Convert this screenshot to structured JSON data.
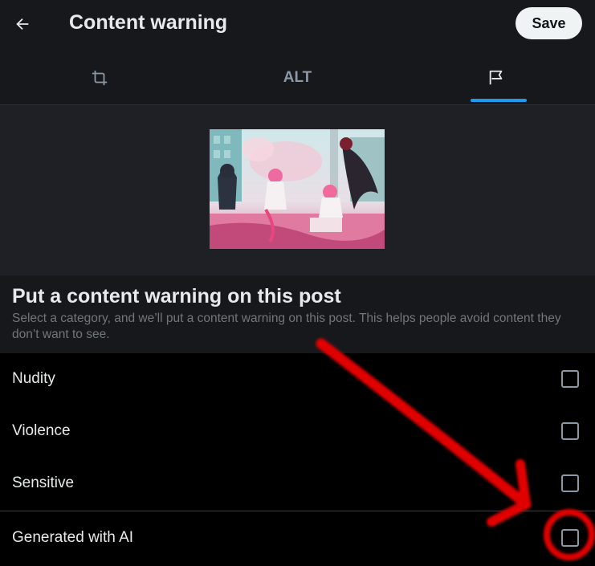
{
  "header": {
    "title": "Content warning",
    "save_label": "Save",
    "back_icon": "arrow-left-icon"
  },
  "tabs": [
    {
      "icon": "crop-icon",
      "label": ""
    },
    {
      "label": "ALT"
    },
    {
      "icon": "flag-icon",
      "label": "",
      "active": true
    }
  ],
  "preview": {
    "image_icon": "anime-illustration-thumbnail"
  },
  "intro": {
    "heading": "Put a content warning on this post",
    "description": "Select a category, and we’ll put a content warning on this post. This helps people avoid content they don’t want to see."
  },
  "options": [
    {
      "label": "Nudity",
      "checked": false
    },
    {
      "label": "Violence",
      "checked": false
    },
    {
      "label": "Sensitive",
      "checked": false
    },
    {
      "label": "Generated with AI",
      "checked": false
    }
  ],
  "colors": {
    "accent": "#1d9bf0",
    "annotation": "#e00000",
    "background": "#000000"
  }
}
